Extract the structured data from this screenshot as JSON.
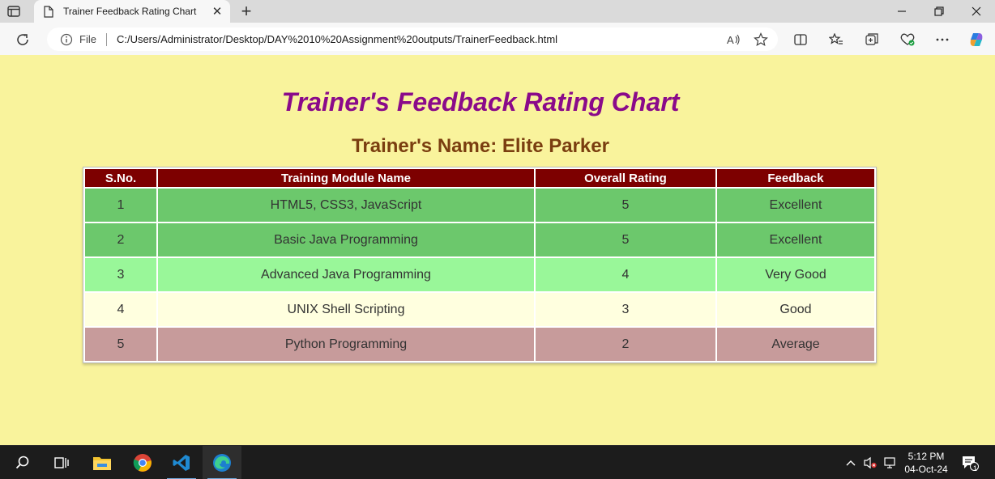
{
  "browser": {
    "tab_title": "Trainer Feedback Rating Chart",
    "tab_close_glyph": "✕",
    "new_tab_glyph": "+",
    "file_label": "File",
    "url": "C:/Users/Administrator/Desktop/DAY%2010%20Assignment%20outputs/TrainerFeedback.html",
    "icons": [
      "tab-actions-icon",
      "document-icon",
      "close-icon",
      "plus-icon",
      "minimize-icon",
      "restore-icon",
      "window-close-icon",
      "refresh-icon",
      "info-icon",
      "read-aloud-icon",
      "favorite-star-icon",
      "split-screen-icon",
      "favorites-icon",
      "collections-icon",
      "performance-icon",
      "more-icon",
      "copilot-icon"
    ]
  },
  "page": {
    "heading": "Trainer's Feedback Rating Chart",
    "trainer_name": "Trainer's Name: Elite Parker",
    "colors": {
      "background": "#f9f39c",
      "heading": "#8a0a8a",
      "trainer_name": "#7a3e10",
      "header_row": "#7d0000",
      "excellent": "#6cc86c",
      "very_good": "#99f799",
      "good": "#ffffdf",
      "average": "#c79b9b"
    },
    "table": {
      "headers": [
        "S.No.",
        "Training Module Name",
        "Overall Rating",
        "Feedback"
      ],
      "rows": [
        {
          "sno": "1",
          "module": "HTML5, CSS3, JavaScript",
          "rating": "5",
          "feedback": "Excellent"
        },
        {
          "sno": "2",
          "module": "Basic Java Programming",
          "rating": "5",
          "feedback": "Excellent"
        },
        {
          "sno": "3",
          "module": "Advanced Java Programming",
          "rating": "4",
          "feedback": "Very Good"
        },
        {
          "sno": "4",
          "module": "UNIX Shell Scripting",
          "rating": "3",
          "feedback": "Good"
        },
        {
          "sno": "5",
          "module": "Python Programming",
          "rating": "2",
          "feedback": "Average"
        }
      ]
    }
  },
  "taskbar": {
    "time": "5:12 PM",
    "date": "04-Oct-24",
    "notification_count": "1",
    "icons": [
      "search-icon",
      "task-view-icon",
      "file-explorer-icon",
      "chrome-icon",
      "vscode-icon",
      "edge-icon",
      "chevron-up-icon",
      "volume-muted-icon",
      "network-icon",
      "notification-icon"
    ]
  }
}
